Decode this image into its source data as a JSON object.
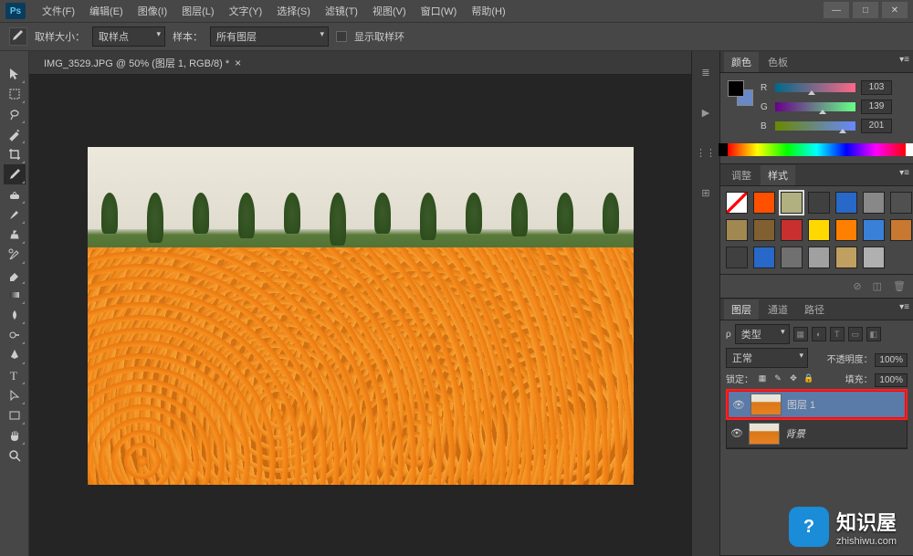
{
  "menu": {
    "file": "文件(F)",
    "edit": "编辑(E)",
    "image": "图像(I)",
    "layer": "图层(L)",
    "type": "文字(Y)",
    "select": "选择(S)",
    "filter": "滤镜(T)",
    "view": "视图(V)",
    "window": "窗口(W)",
    "help": "帮助(H)"
  },
  "options": {
    "sample_size_label": "取样大小：",
    "sample_size_value": "取样点",
    "sample_label": "样本：",
    "sample_value": "所有图层",
    "show_ring": "显示取样环"
  },
  "document": {
    "tab_title": "IMG_3529.JPG @ 50% (图层 1, RGB/8) *"
  },
  "color_panel": {
    "tab_color": "颜色",
    "tab_swatches": "色板",
    "r_label": "R",
    "r_value": "103",
    "g_label": "G",
    "g_value": "139",
    "b_label": "B",
    "b_value": "201",
    "fg_hex": "#000000",
    "bg_hex": "#6888c8"
  },
  "adjust_panel": {
    "tab_adjust": "调整",
    "tab_styles": "样式",
    "swatches": [
      "#ffffff",
      "#ff5000",
      "#b0b080",
      "#404040",
      "#2868c8",
      "#888888",
      "#505050",
      "#a08850",
      "#806030",
      "#c83030",
      "#ffd800",
      "#ff8000",
      "#3880d8",
      "#c87830",
      "#404040",
      "#2868c8",
      "#707070",
      "#a0a0a0",
      "#c0a060",
      "#b0b0b0"
    ]
  },
  "layers_panel": {
    "tab_layers": "图层",
    "tab_channels": "通道",
    "tab_paths": "路径",
    "kind_label": "类型",
    "blend_mode": "正常",
    "opacity_label": "不透明度：",
    "opacity_value": "100%",
    "lock_label": "锁定：",
    "fill_label": "填充：",
    "fill_value": "100%",
    "layer1_name": "图层 1",
    "background_name": "背景"
  },
  "watermark": {
    "title": "知识屋",
    "url": "zhishiwu.com",
    "icon_text": "?"
  },
  "win": {
    "min": "—",
    "max": "□",
    "close": "✕"
  }
}
